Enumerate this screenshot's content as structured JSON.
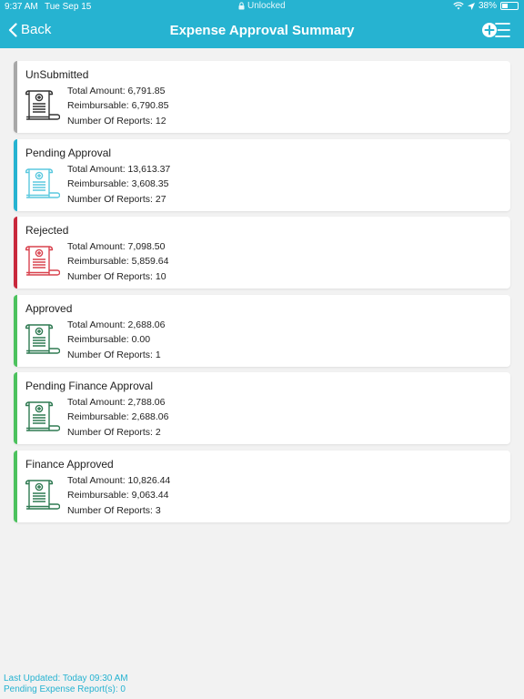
{
  "status_bar": {
    "time": "9:37 AM",
    "date": "Tue Sep 15",
    "lock_label": "Unlocked",
    "battery": "38%",
    "battery_level": 0.38
  },
  "nav": {
    "back_label": "Back",
    "title": "Expense Approval Summary"
  },
  "labels": {
    "total": "Total Amount: ",
    "reimbursable": "Reimbursable: ",
    "reports": "Number Of Reports: "
  },
  "cards": [
    {
      "title": "UnSubmitted",
      "total": "6,791.85",
      "reimbursable": "6,790.85",
      "reports": "12",
      "color": "#a8a8a8",
      "icon_color": "#333333"
    },
    {
      "title": "Pending Approval",
      "total": "13,613.37",
      "reimbursable": "3,608.35",
      "reports": "27",
      "color": "#26b3d1",
      "icon_color": "#5cc9df"
    },
    {
      "title": "Rejected",
      "total": "7,098.50",
      "reimbursable": "5,859.64",
      "reports": "10",
      "color": "#c8283c",
      "icon_color": "#d9434f"
    },
    {
      "title": "Approved",
      "total": "2,688.06",
      "reimbursable": "0.00",
      "reports": "1",
      "color": "#4cc25e",
      "icon_color": "#2f7a52"
    },
    {
      "title": "Pending Finance Approval",
      "total": "2,788.06",
      "reimbursable": "2,688.06",
      "reports": "2",
      "color": "#4cc25e",
      "icon_color": "#2f7a52"
    },
    {
      "title": "Finance Approved",
      "total": "10,826.44",
      "reimbursable": "9,063.44",
      "reports": "3",
      "color": "#4cc25e",
      "icon_color": "#2f7a52"
    }
  ],
  "footer": {
    "last_updated": "Last Updated: Today 09:30 AM",
    "pending": "Pending Expense Report(s): 0"
  }
}
